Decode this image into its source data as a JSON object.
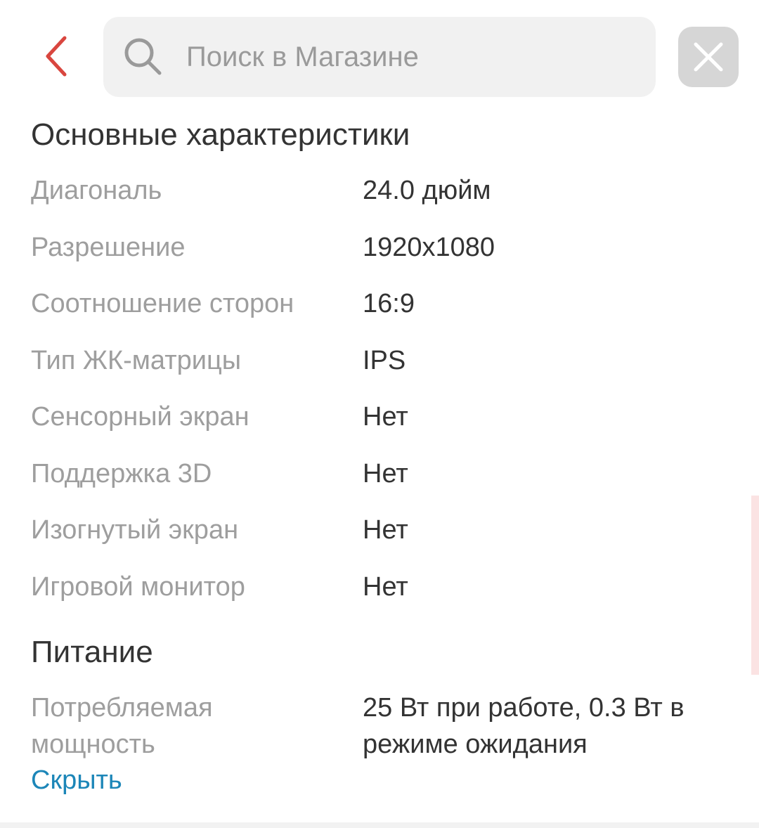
{
  "header": {
    "search_placeholder": "Поиск в Магазине",
    "accent_color": "#d9463f"
  },
  "sections": [
    {
      "title": "Основные характеристики",
      "rows": [
        {
          "label": "Диагональ",
          "value": "24.0 дюйм"
        },
        {
          "label": "Разрешение",
          "value": "1920x1080"
        },
        {
          "label": "Соотношение сторон",
          "value": "16:9"
        },
        {
          "label": "Тип ЖК-матрицы",
          "value": "IPS"
        },
        {
          "label": "Сенсорный экран",
          "value": "Нет"
        },
        {
          "label": "Поддержка 3D",
          "value": "Нет"
        },
        {
          "label": "Изогнутый экран",
          "value": "Нет"
        },
        {
          "label": "Игровой монитор",
          "value": "Нет"
        }
      ]
    },
    {
      "title": "Питание",
      "rows": [
        {
          "label": "Потребляемая мощность",
          "value": "25 Вт при работе, 0.3 Вт в режиме ожидания"
        }
      ]
    }
  ],
  "hide_link": "Скрыть",
  "link_color": "#1c86b8"
}
